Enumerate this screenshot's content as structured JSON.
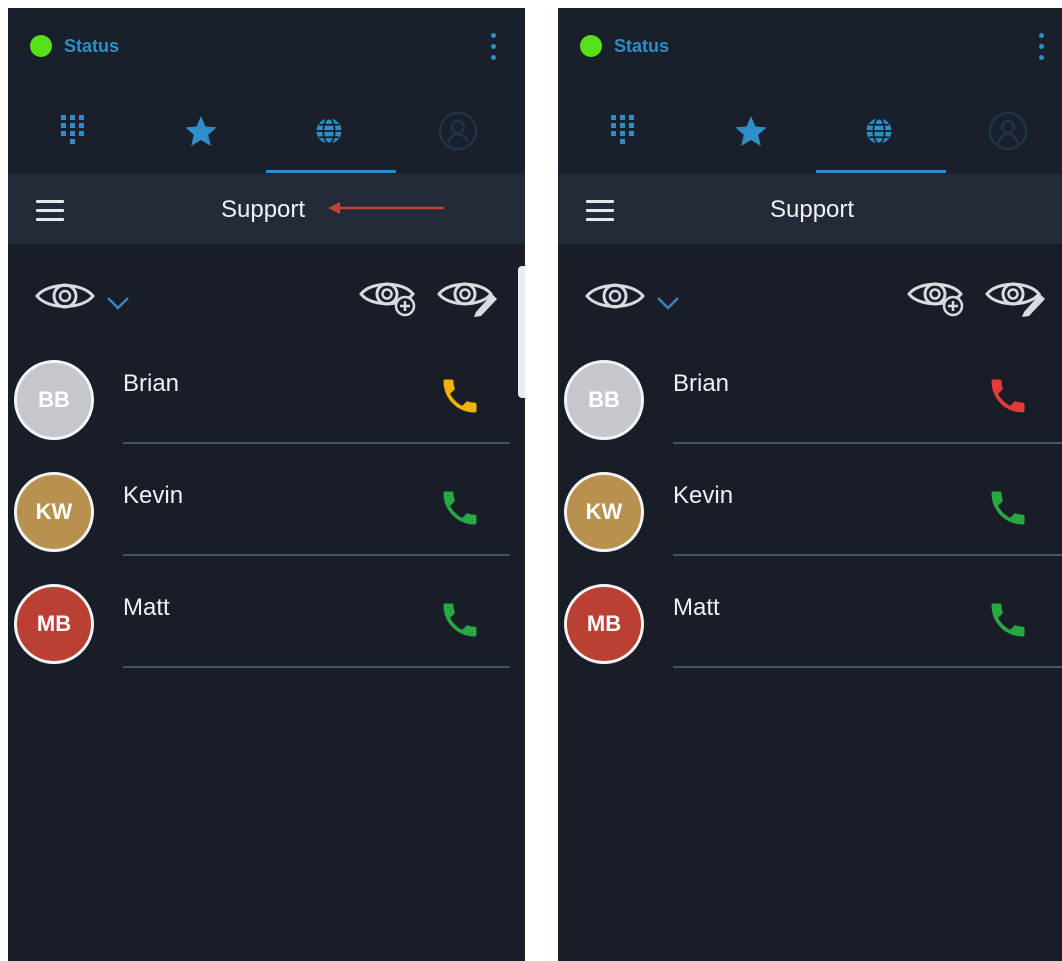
{
  "status_label": "Status",
  "header_title": "Support",
  "tabs": [
    {
      "name": "dialpad",
      "icon": "dialpad-icon"
    },
    {
      "name": "favorites",
      "icon": "star-icon"
    },
    {
      "name": "directory",
      "icon": "globe-icon",
      "active": true
    },
    {
      "name": "profile",
      "icon": "user-icon"
    }
  ],
  "contacts": [
    {
      "initials": "BB",
      "name": "Brian",
      "avatar_color": "#c4c8cc"
    },
    {
      "initials": "KW",
      "name": "Kevin",
      "avatar_color": "#b8914e"
    },
    {
      "initials": "MB",
      "name": "Matt",
      "avatar_color": "#b94032"
    }
  ],
  "screens": {
    "left": {
      "call_colors": [
        "#f0b400",
        "#27a844",
        "#27a844"
      ]
    },
    "right": {
      "call_colors": [
        "#e53a3a",
        "#27a844",
        "#27a844"
      ]
    }
  },
  "colors": {
    "background": "#181d28",
    "accent": "#2e8ec8",
    "status": "#58e01a",
    "annotation_arrow": "#c0442f"
  }
}
